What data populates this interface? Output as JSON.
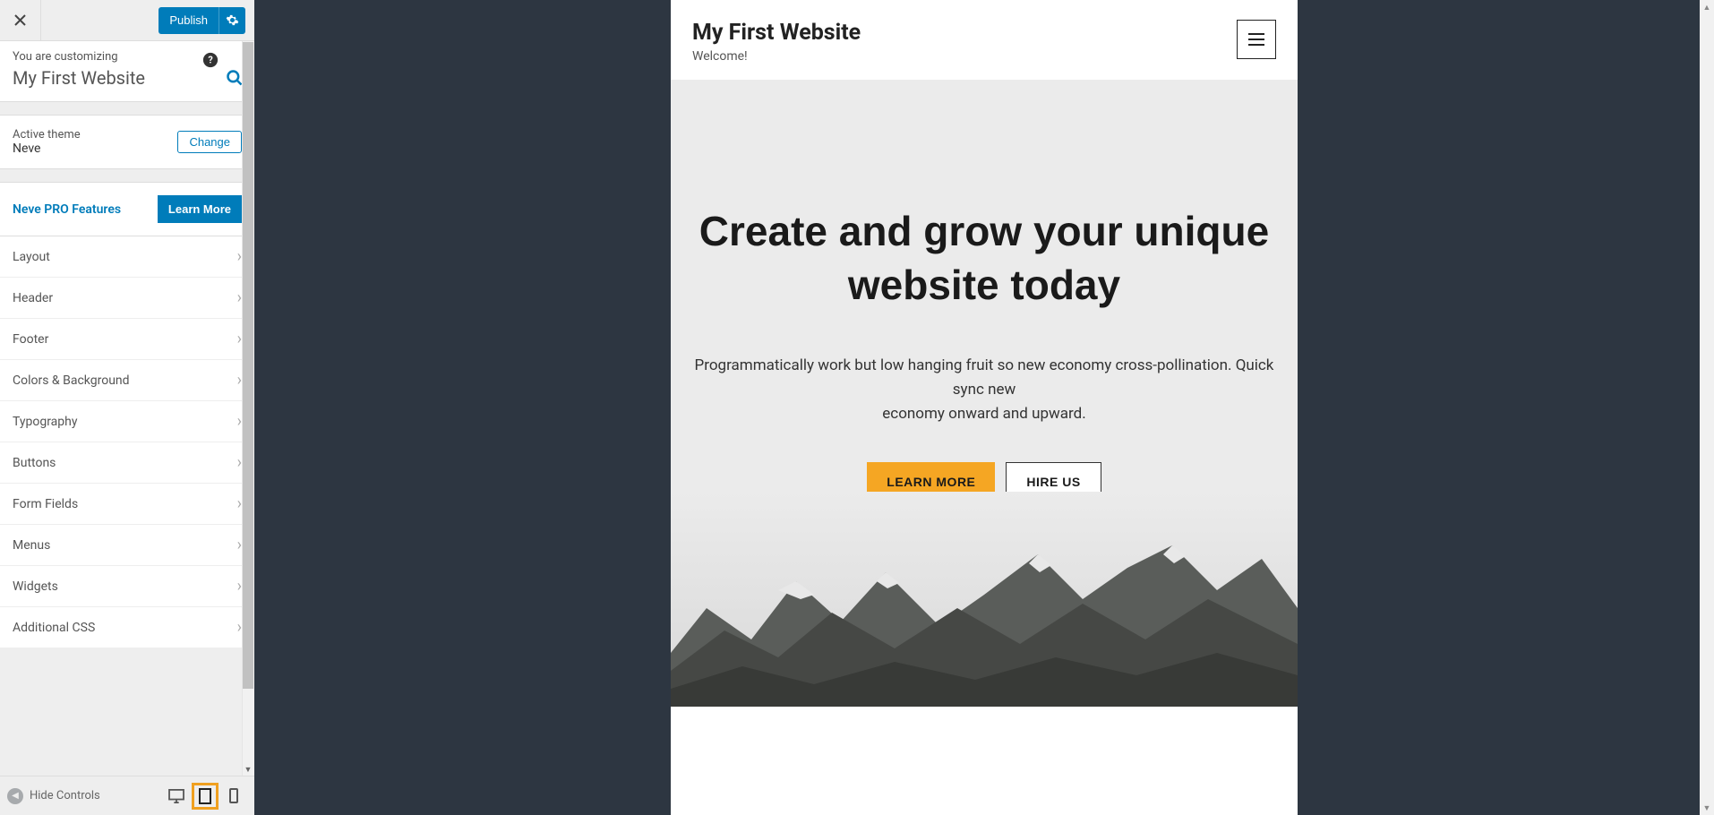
{
  "sidebar": {
    "publish_label": "Publish",
    "customizing_label": "You are customizing",
    "site_title": "My First Website",
    "active_theme_label": "Active theme",
    "theme_name": "Neve",
    "change_label": "Change",
    "pro_label": "Neve PRO Features",
    "learn_more_label": "Learn More",
    "panels": [
      {
        "label": "Layout"
      },
      {
        "label": "Header"
      },
      {
        "label": "Footer"
      },
      {
        "label": "Colors & Background"
      },
      {
        "label": "Typography"
      },
      {
        "label": "Buttons"
      },
      {
        "label": "Form Fields"
      },
      {
        "label": "Menus"
      },
      {
        "label": "Widgets"
      },
      {
        "label": "Additional CSS"
      }
    ],
    "hide_controls_label": "Hide Controls"
  },
  "preview": {
    "site_title": "My First Website",
    "tagline": "Welcome!",
    "hero_heading": "Create and grow your unique website today",
    "hero_sub_line1": "Programmatically work but low hanging fruit so new economy cross-pollination. Quick sync new",
    "hero_sub_line2": "economy onward and upward.",
    "btn_primary": "LEARN MORE",
    "btn_secondary": "HIRE US"
  }
}
